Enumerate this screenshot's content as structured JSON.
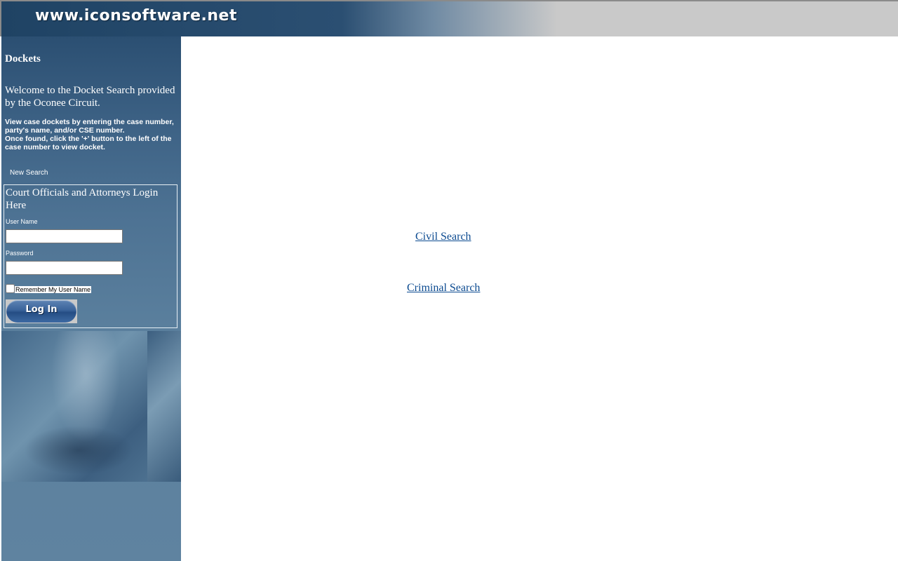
{
  "header": {
    "title": "www.iconsoftware.net"
  },
  "sidebar": {
    "section_title": "Dockets",
    "welcome": "Welcome to the Docket Search provided by the Oconee Circuit.",
    "instructions_line1": "View case dockets by entering the case number, party's name, and/or CSE number.",
    "instructions_line2": "Once found, click the '+' button to the left of the case number to view docket.",
    "new_search_label": "New Search",
    "login": {
      "title": "Court Officials and Attorneys Login Here",
      "username_label": "User Name",
      "username_value": "",
      "password_label": "Password",
      "password_value": "",
      "remember_label": "Remember My User Name",
      "remember_checked": false,
      "button_label": "Log In"
    }
  },
  "main": {
    "civil_search_label": "Civil Search",
    "criminal_search_label": "Criminal Search"
  },
  "colors": {
    "link": "#0b4a90",
    "sidebar_top": "#2b4f72",
    "sidebar_bottom": "#5f83a0",
    "header_gray": "#c9c9c9"
  }
}
